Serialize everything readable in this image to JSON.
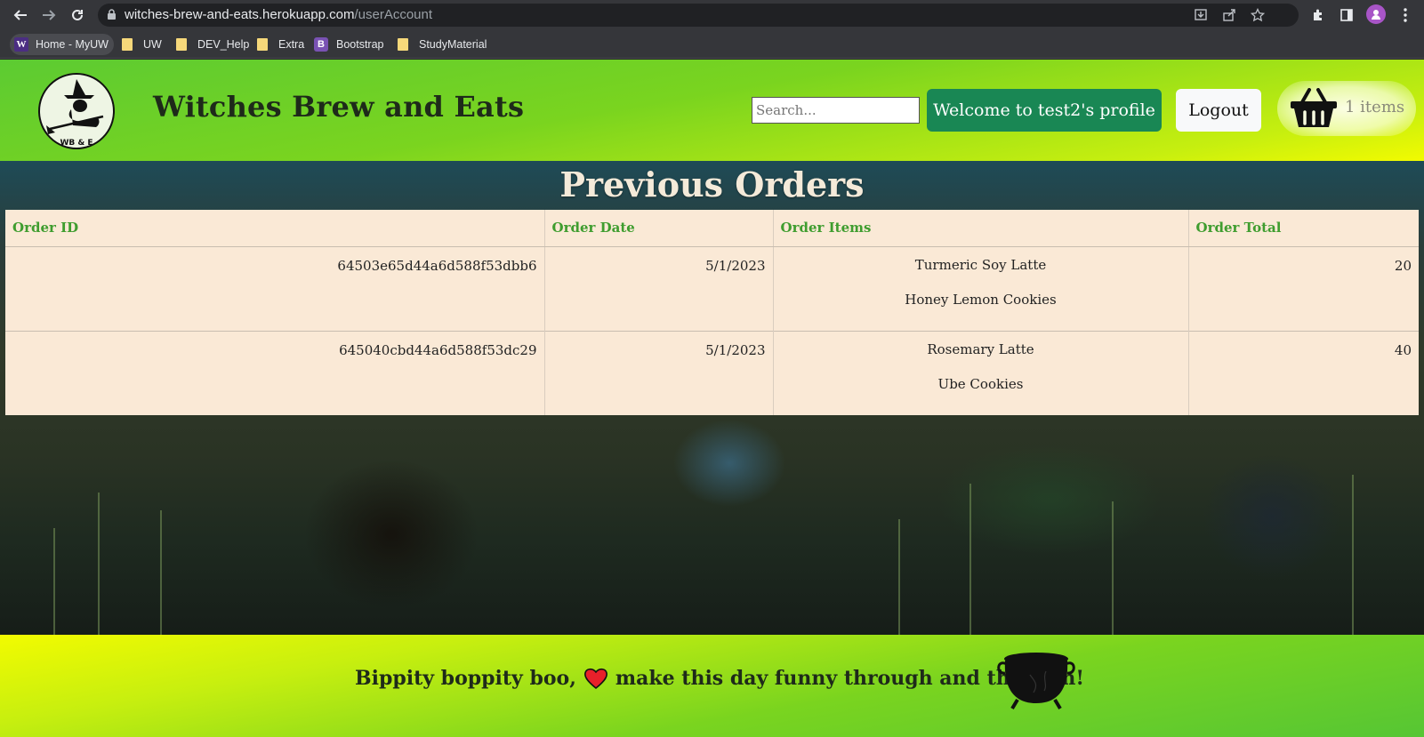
{
  "browser": {
    "url_host": "witches-brew-and-eats.herokuapp.com",
    "url_path": "/userAccount",
    "bookmarks": [
      {
        "label": "Home - MyUW",
        "icon": "uw-logo-icon"
      },
      {
        "label": "UW",
        "icon": "folder-icon"
      },
      {
        "label": "DEV_Help",
        "icon": "folder-icon"
      },
      {
        "label": "Extra",
        "icon": "folder-icon"
      },
      {
        "label": "Bootstrap",
        "icon": "bootstrap-logo-icon"
      },
      {
        "label": "StudyMaterial",
        "icon": "folder-icon"
      }
    ]
  },
  "header": {
    "logo_text": "WB & E",
    "title": "Witches Brew and Eats",
    "search_placeholder": "Search...",
    "welcome_label": "Welcome to test2's profile",
    "logout_label": "Logout",
    "cart_count_label": "1 items"
  },
  "main": {
    "title": "Previous Orders",
    "columns": [
      "Order ID",
      "Order Date",
      "Order Items",
      "Order Total"
    ],
    "orders": [
      {
        "id": "64503e65d44a6d588f53dbb6",
        "date": "5/1/2023",
        "items": [
          "Turmeric Soy Latte",
          "Honey Lemon Cookies"
        ],
        "total": "20"
      },
      {
        "id": "645040cbd44a6d588f53dc29",
        "date": "5/1/2023",
        "items": [
          "Rosemary Latte",
          "Ube Cookies"
        ],
        "total": "40"
      }
    ]
  },
  "footer": {
    "text_before": "Bippity boppity boo,",
    "text_after": "make this day funny through and through!"
  },
  "colors": {
    "header_green": "#5ccb32",
    "header_yellow": "#f2fb00",
    "welcome_button": "#198754",
    "table_bg": "#fae9d6",
    "table_header_text": "#3f9d2f"
  }
}
